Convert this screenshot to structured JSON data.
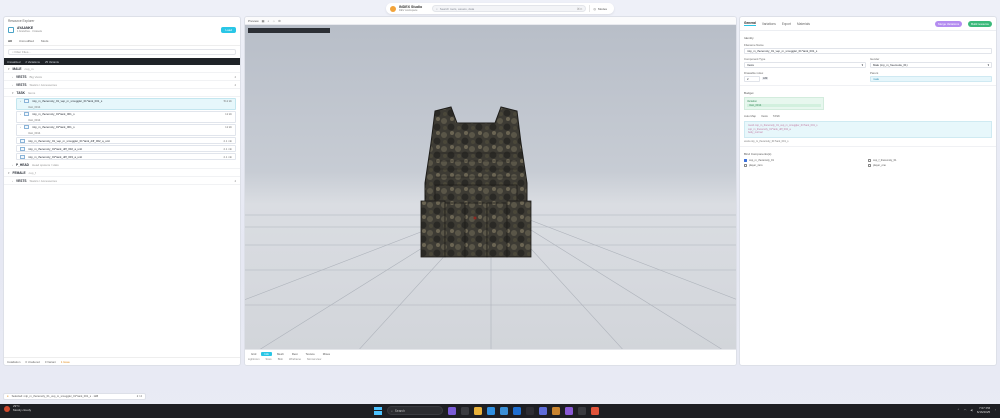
{
  "topbar": {
    "app_name": "INDEX Studio",
    "app_sub": "DEV workspace",
    "search_placeholder": "Search tools, assets, data",
    "shortcut": "⌘ K",
    "mode_label": "Modes"
  },
  "left_panel": {
    "title": "Resource Explorer",
    "project": {
      "name": "AYAANKE",
      "meta": "1 branches · 3 Assets",
      "load_label": "Load"
    },
    "tabs": [
      "All",
      "Unmodified",
      "Mods"
    ],
    "filter_placeholder": "Filter Files...",
    "dark_bar": [
      "Unrealized",
      "2 Variations",
      "25 Variants"
    ],
    "tree": {
      "male": {
        "label": "MALE",
        "sub": "cop_m",
        "count": ""
      },
      "vests_heavy": {
        "label": "VESTS",
        "sub": "Big Vests",
        "count": "4"
      },
      "vests_acc": {
        "label": "VESTS",
        "sub": "Statics / Accessories",
        "count": "4"
      },
      "task": {
        "label": "TASK",
        "sub": "Items"
      },
      "items": [
        {
          "name": "mtp_m_theremoly_01_vep_m_smuggler_01*tank_001_s",
          "size": "512 kb",
          "tag": "Vest_0014"
        },
        {
          "name": "mtp_m_theremoly_01*tank_001_s",
          "size": "12 kb",
          "tag": "Vest_0014"
        },
        {
          "name": "mtp_m_theremoly_01*tank_001_s",
          "size": "12 kb",
          "tag": "Vest_0014"
        },
        {
          "name": "mtp_m_theremoly_01_vep_m_smuggler_01*tank_diff_002_a_unit",
          "size": "2.1 mb"
        },
        {
          "name": "mtp_m_theremoly_01*tank_diff_002_a_unit",
          "size": "2.1 mb"
        },
        {
          "name": "mtp_m_theremoly_01*tank_diff_003_a_unit",
          "size": "2.1 mb"
        }
      ],
      "p_heads": {
        "label": "P_HEAD",
        "sub": "Head spawns / Hats"
      },
      "female": {
        "label": "FEMALE",
        "sub": "cop_f"
      },
      "vests_f": {
        "label": "VESTS",
        "sub": "Statics / Accessories",
        "count": "4"
      }
    },
    "footer": [
      "Installation",
      "0 Unaltered",
      "0 Variant",
      "1 Issue"
    ]
  },
  "center_panel": {
    "title": "Preview",
    "footer_tabs": [
      "Grid",
      "Info",
      "Mesh",
      "Rest",
      "Texture",
      "Mixes"
    ],
    "footer_sub": [
      "Lightroom",
      "Store",
      "Blob",
      "Wireframe",
      "Normal view"
    ]
  },
  "right_panel": {
    "tabs": [
      "General",
      "Variations",
      "Export",
      "Materials"
    ],
    "merge_label": "Merge Variations",
    "build_label": "Build resource",
    "section_identity": "Identity",
    "filename_label": "Filename Name",
    "filename_value": "mtp_m_theremoly_01_vep_m_smuggler_01*tank_001_s",
    "component_type_label": "Component Type",
    "component_type_value": "Vests",
    "gender_label": "Gender",
    "gender_value": "Male (mp_m_freemode_01)",
    "drawable_label": "Drawable index",
    "drawable_value": "2",
    "drawable_badge": "ANI",
    "parent_label": "Parent",
    "parent_value": "male",
    "section_budget": "Budget",
    "budget_heading": "Variation",
    "budget_value": "Vest_0014",
    "mini_tabs": [
      "Auto Map",
      "Vests",
      "TASK"
    ],
    "code_lines": [
      "mesh  cop_m_theremoly_01_vep_m_smuggler_01*tank_001_s",
      "         cop_m_theremoly_01*tank_diff_002_a",
      "         body_normal"
    ],
    "code_meta": "vests  cop_m_theremoly_01*tank_001_s",
    "section_flags": "Bind Components(s)",
    "flags": [
      {
        "label": "cop_m_theremoly_01",
        "checked": true
      },
      {
        "label": "cop_f_theremoly_01",
        "checked": false
      },
      {
        "label": "player_zero",
        "checked": false
      },
      {
        "label": "player_one",
        "checked": false
      }
    ]
  },
  "toast": {
    "text": "Selected: mtp_m_theremoly_01_vep_m_smuggler_01*tank_001_s · 1kB",
    "count": "2 / 2"
  },
  "taskbar": {
    "weather_temp": "29°C",
    "weather_desc": "Mostly cloudy",
    "search_label": "Search",
    "time": "7:07 PM",
    "date": "6/16/2025"
  }
}
